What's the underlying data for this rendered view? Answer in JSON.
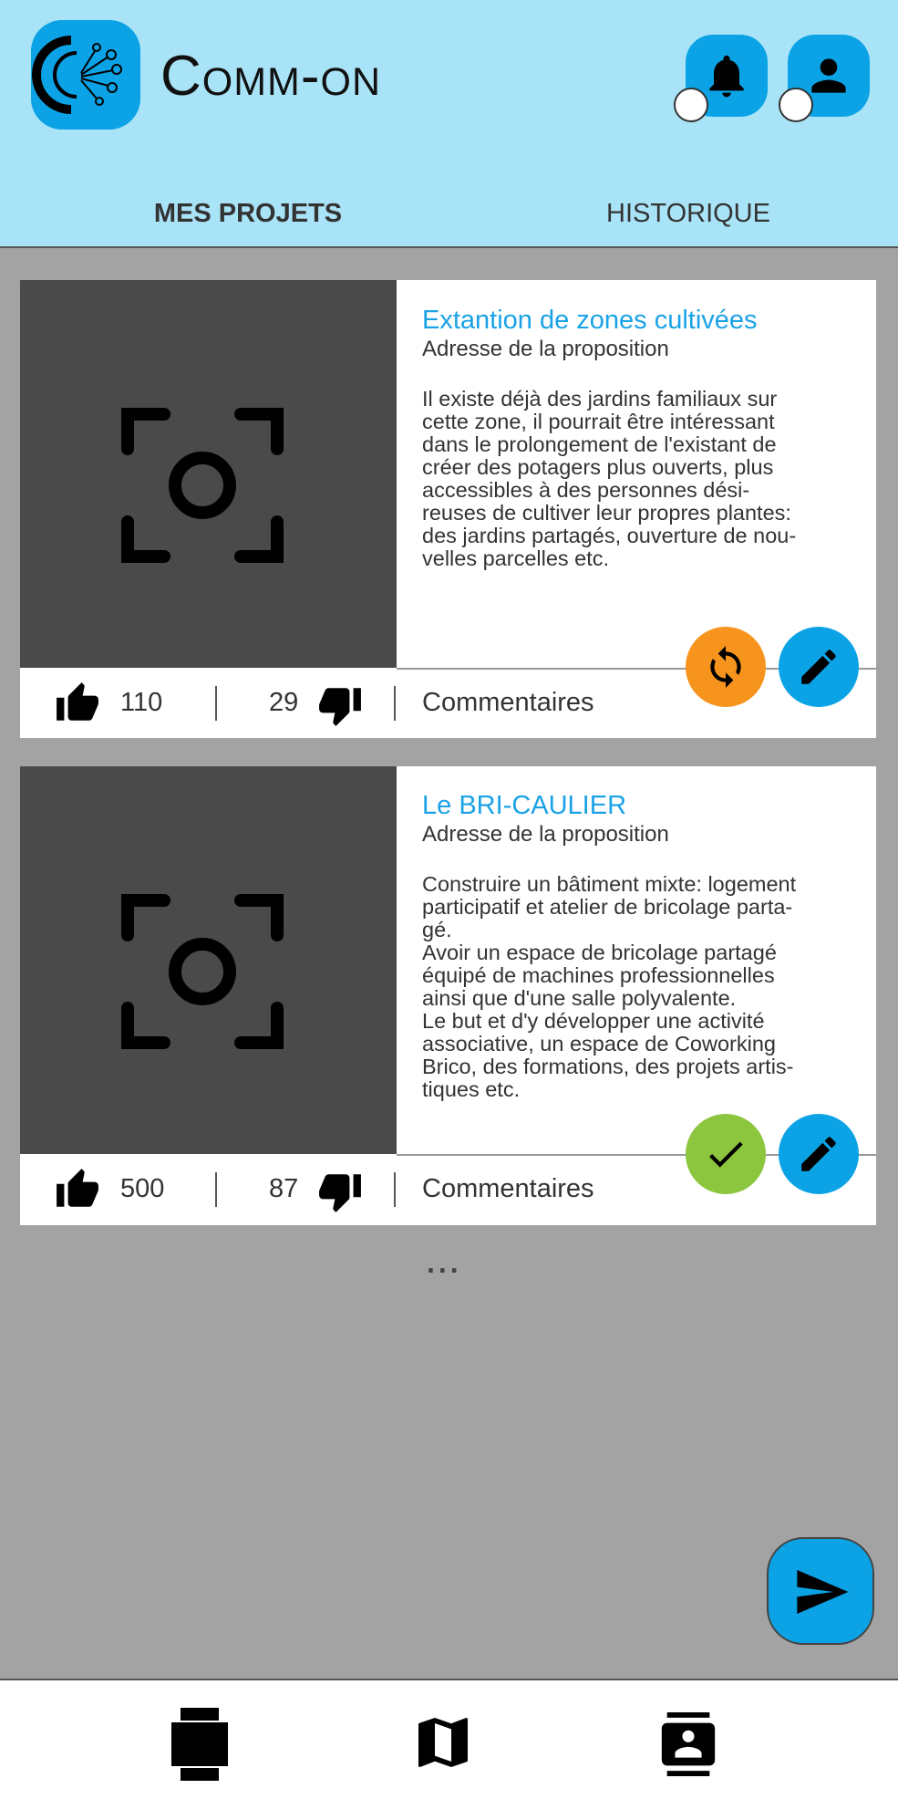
{
  "app": {
    "name": "Comm-on",
    "colors": {
      "accent": "#0ba3e6",
      "header_bg": "#a9e3f7",
      "page_bg": "#a3a3a3",
      "pending": "#f7941d",
      "approved": "#8cc63f"
    }
  },
  "header": {
    "logo_icon": "network-logo-icon",
    "notifications_icon": "bell-icon",
    "profile_icon": "user-icon"
  },
  "tabs": [
    {
      "label": "MES PROJETS",
      "active": true
    },
    {
      "label": "HISTORIQUE",
      "active": false
    }
  ],
  "projects": [
    {
      "title": "Extantion de zones cultivées",
      "address": "Adresse de la proposition",
      "description": "Il existe déjà des jardins familiaux sur\ncette zone, il pourrait être intéressant\ndans le prolongement de l'existant de\ncréer des potagers plus ouverts, plus\naccessibles à des personnes dési-\nreuses de cultiver leur propres plantes:\ndes jardins partagés, ouverture de nou-\nvelles parcelles etc.",
      "likes": "110",
      "dislikes": "29",
      "comments_label": "Commentaires",
      "status_icon": "refresh-icon",
      "edit_icon": "pencil-icon"
    },
    {
      "title": "Le BRI-CAULIER",
      "address": "Adresse de la proposition",
      "description": "Construire un bâtiment mixte: logement\nparticipatif et atelier de bricolage parta-\ngé.\nAvoir un espace de bricolage partagé\néquipé de machines professionnelles\nainsi que d'une salle polyvalente.\nLe but et d'y développer une activité\nassociative, un espace de Coworking\nBrico, des formations, des projets artis-\ntiques etc.",
      "likes": "500",
      "dislikes": "87",
      "comments_label": "Commentaires",
      "status_icon": "check-icon",
      "edit_icon": "pencil-icon"
    }
  ],
  "more_indicator": "...",
  "fab_icon": "send-icon",
  "bottom_nav": [
    {
      "icon": "watch-icon"
    },
    {
      "icon": "map-icon"
    },
    {
      "icon": "contacts-icon"
    }
  ]
}
